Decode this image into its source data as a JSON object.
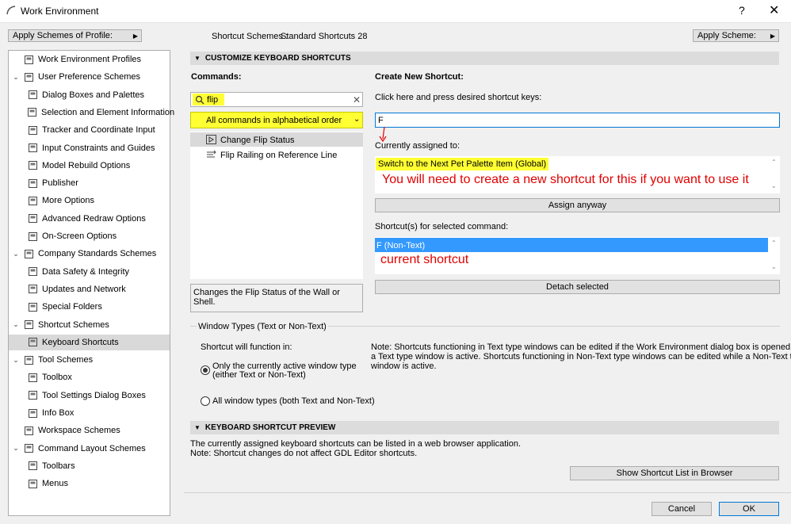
{
  "window": {
    "title": "Work Environment",
    "help": "?",
    "close": "✕"
  },
  "top": {
    "apply_profile": "Apply Schemes of Profile:",
    "shortcut_schemes_label": "Shortcut Schemes :",
    "shortcut_schemes_value": "Standard Shortcuts 28",
    "apply_scheme": "Apply Scheme:"
  },
  "tree": [
    {
      "label": "Work Environment Profiles",
      "icon": "profiles-icon",
      "level": 0,
      "toggle": ""
    },
    {
      "label": "User Preference Schemes",
      "icon": "user-schemes-icon",
      "level": 0,
      "toggle": "v"
    },
    {
      "label": "Dialog Boxes and Palettes",
      "icon": "dialog-boxes-icon",
      "level": 1,
      "toggle": ""
    },
    {
      "label": "Selection and Element Information",
      "icon": "selection-icon",
      "level": 1,
      "toggle": ""
    },
    {
      "label": "Tracker and Coordinate Input",
      "icon": "tracker-icon",
      "level": 1,
      "toggle": ""
    },
    {
      "label": "Input Constraints and Guides",
      "icon": "input-constraints-icon",
      "level": 1,
      "toggle": ""
    },
    {
      "label": "Model Rebuild Options",
      "icon": "model-rebuild-icon",
      "level": 1,
      "toggle": ""
    },
    {
      "label": "Publisher",
      "icon": "publisher-icon",
      "level": 1,
      "toggle": ""
    },
    {
      "label": "More Options",
      "icon": "more-options-icon",
      "level": 1,
      "toggle": ""
    },
    {
      "label": "Advanced Redraw Options",
      "icon": "redraw-icon",
      "level": 1,
      "toggle": ""
    },
    {
      "label": "On-Screen Options",
      "icon": "on-screen-icon",
      "level": 1,
      "toggle": ""
    },
    {
      "label": "Company Standards Schemes",
      "icon": "company-schemes-icon",
      "level": 0,
      "toggle": "v"
    },
    {
      "label": "Data Safety & Integrity",
      "icon": "data-safety-icon",
      "level": 1,
      "toggle": ""
    },
    {
      "label": "Updates and Network",
      "icon": "network-icon",
      "level": 1,
      "toggle": ""
    },
    {
      "label": "Special Folders",
      "icon": "folders-icon",
      "level": 1,
      "toggle": ""
    },
    {
      "label": "Shortcut Schemes",
      "icon": "shortcut-schemes-icon",
      "level": 0,
      "toggle": "v"
    },
    {
      "label": "Keyboard Shortcuts",
      "icon": "keyboard-shortcuts-icon",
      "level": 1,
      "toggle": "",
      "selected": true
    },
    {
      "label": "Tool Schemes",
      "icon": "tool-schemes-icon",
      "level": 0,
      "toggle": "v"
    },
    {
      "label": "Toolbox",
      "icon": "toolbox-icon",
      "level": 1,
      "toggle": ""
    },
    {
      "label": "Tool Settings Dialog Boxes",
      "icon": "tool-settings-icon",
      "level": 1,
      "toggle": ""
    },
    {
      "label": "Info Box",
      "icon": "info-box-icon",
      "level": 1,
      "toggle": ""
    },
    {
      "label": "Workspace Schemes",
      "icon": "workspace-icon",
      "level": 0,
      "toggle": ""
    },
    {
      "label": "Command Layout Schemes",
      "icon": "command-layout-icon",
      "level": 0,
      "toggle": "v"
    },
    {
      "label": "Toolbars",
      "icon": "toolbars-icon",
      "level": 1,
      "toggle": ""
    },
    {
      "label": "Menus",
      "icon": "menus-icon",
      "level": 1,
      "toggle": ""
    }
  ],
  "customize": {
    "header": "CUSTOMIZE KEYBOARD SHORTCUTS",
    "commands_label": "Commands:",
    "search_value": "flip",
    "filter_value": "All commands in alphabetical order",
    "commands": [
      {
        "label": "Change Flip Status",
        "icon": "play-icon",
        "selected": true
      },
      {
        "label": "Flip Railing on Reference Line",
        "icon": "railing-icon",
        "selected": false
      }
    ],
    "description": "Changes the Flip Status of the Wall or Shell.",
    "create_label": "Create New Shortcut:",
    "press_hint": "Click here and press desired shortcut keys:",
    "shortcut_value": "F",
    "currently_assigned_label": "Currently assigned to:",
    "assigned_value": "Switch to the Next Pet Palette Item (Global)",
    "annotation_need_new": "You will need to create a new shortcut for this if you want to use it",
    "assign_anyway": "Assign anyway",
    "shortcuts_for_label": "Shortcut(s) for selected command:",
    "shortcut_item": "F (Non-Text)",
    "annotation_current": "current shortcut",
    "detach_selected": "Detach selected"
  },
  "window_types": {
    "group_label": "Window Types (Text or Non-Text)",
    "function_in": "Shortcut will function in:",
    "option1_line1": "Only the currently active window type",
    "option1_line2": "(either Text or Non-Text)",
    "option2": "All window types (both Text and Non-Text)",
    "note_line1": "Note: Shortcuts functioning in Text type windows can be edited if the Work Environment dialog box is opened while",
    "note_line2": "a Text type window is active. Shortcuts functioning in Non-Text type windows can be edited while a Non-Text type",
    "note_line3": "window is active.",
    "selected_option": 1
  },
  "preview": {
    "header": "KEYBOARD SHORTCUT PREVIEW",
    "line1": "The currently assigned keyboard shortcuts can be listed in a web browser application.",
    "line2": "Note: Shortcut changes do not affect GDL Editor shortcuts.",
    "show_button": "Show Shortcut List in Browser"
  },
  "footer": {
    "cancel": "Cancel",
    "ok": "OK"
  },
  "colors": {
    "highlight": "#ffff33",
    "selection_blue": "#3399ff",
    "annotation_red": "#e00000",
    "focus_border": "#0078d7"
  }
}
